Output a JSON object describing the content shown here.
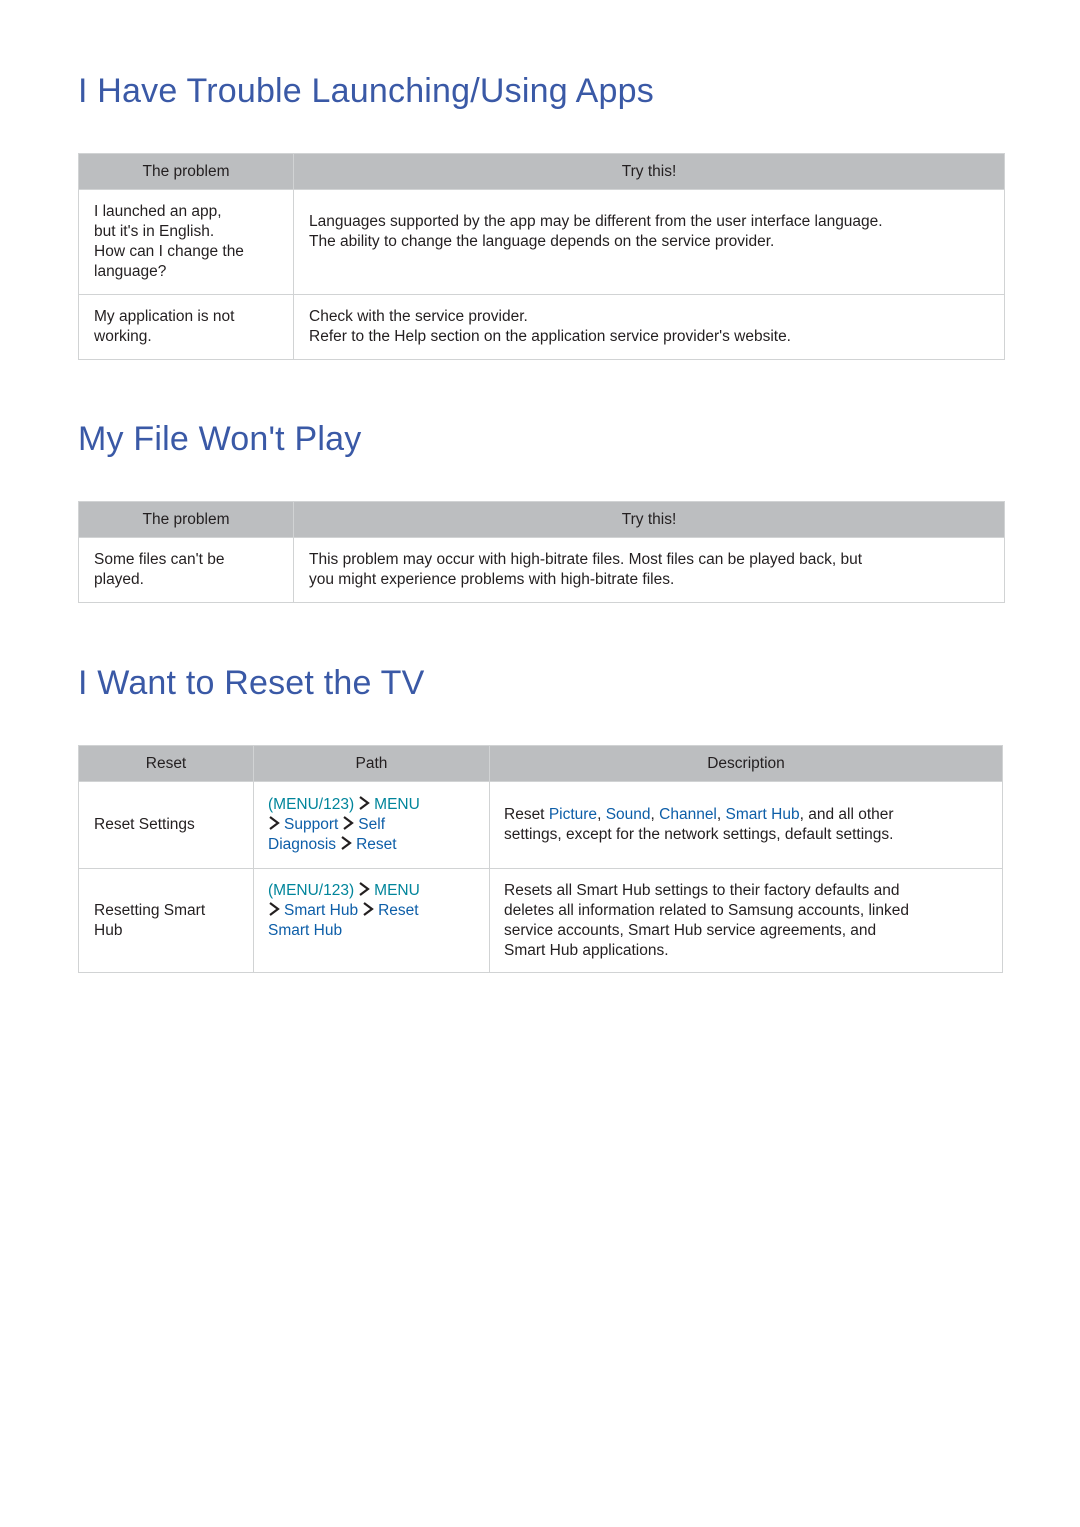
{
  "sections": [
    {
      "title": "I Have Trouble Launching/Using Apps",
      "headers": [
        "The problem",
        "Try this!"
      ],
      "rows": [
        {
          "problem": [
            "I launched an app,",
            "but it's in English.",
            "How can I change the",
            "language?"
          ],
          "solution": [
            "Languages supported by the app may be different from the user interface language.",
            "The ability to change the language depends on the service provider."
          ]
        },
        {
          "problem": [
            "My application is not",
            "working."
          ],
          "solution": [
            "Check with the service provider.",
            "Refer to the Help section on the application service provider's website."
          ]
        }
      ]
    },
    {
      "title": "My File Won't Play",
      "headers": [
        "The problem",
        "Try this!"
      ],
      "rows": [
        {
          "problem": [
            "Some files can't be",
            "played."
          ],
          "solution": [
            "This problem may occur with high-bitrate files. Most files can be played back, but",
            "you might experience problems with high-bitrate files."
          ]
        }
      ]
    },
    {
      "title": "I Want to Reset the TV",
      "headers": [
        "Reset",
        "Path",
        "Description"
      ],
      "rows": [
        {
          "reset": [
            "Reset Settings"
          ],
          "path": {
            "remote": "MENU/123",
            "steps": [
              "MENU",
              "Support",
              "Self Diagnosis",
              "Reset"
            ]
          },
          "description": {
            "prefix": "Reset ",
            "links": [
              "Picture",
              "Sound",
              "Channel",
              "Smart Hub"
            ],
            "suffix": ", and all other",
            "line2": "settings, except for the network settings, default settings."
          }
        },
        {
          "reset": [
            "Resetting Smart",
            "Hub"
          ],
          "path": {
            "remote": "MENU/123",
            "steps": [
              "MENU",
              "Smart Hub",
              "Reset Smart Hub"
            ]
          },
          "description": {
            "lines": [
              "Resets all Smart Hub settings to their factory defaults and",
              "deletes all information related to Samsung accounts, linked",
              "service accounts, Smart Hub service agreements, and",
              "Smart Hub applications."
            ]
          }
        }
      ]
    }
  ],
  "colors": {
    "heading": "#3a59a6",
    "header_bg": "#bcbec0",
    "border": "#d1d3d4",
    "menu_teal": "#00859b",
    "link_blue": "#0d5ea8"
  }
}
